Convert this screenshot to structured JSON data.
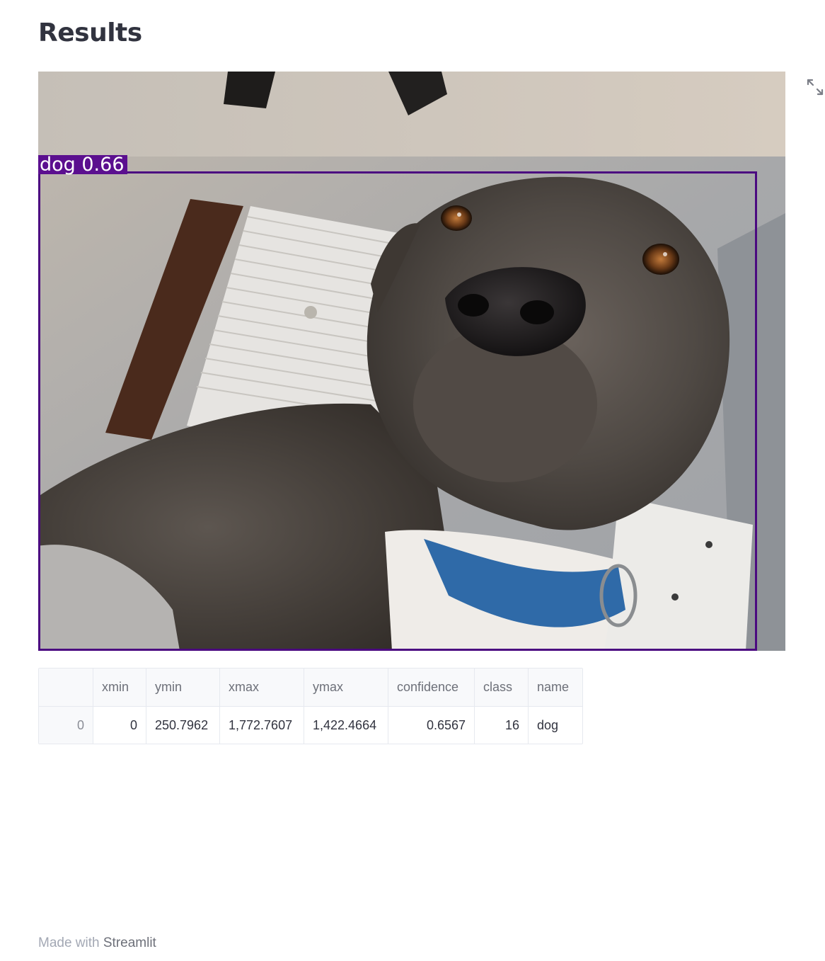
{
  "page": {
    "title": "Results"
  },
  "image": {
    "detection_label": "dog 0.66",
    "detection_color": "#4b0a80",
    "expand_icon": "fullscreen-expand-icon"
  },
  "table": {
    "columns": [
      "",
      "xmin",
      "ymin",
      "xmax",
      "ymax",
      "confidence",
      "class",
      "name"
    ],
    "rows": [
      {
        "index": "0",
        "xmin": "0",
        "ymin": "250.7962",
        "xmax": "1,772.7607",
        "ymax": "1,422.4664",
        "confidence": "0.6567",
        "class": "16",
        "name": "dog"
      }
    ]
  },
  "footer": {
    "prefix": "Made with ",
    "brand": "Streamlit"
  }
}
